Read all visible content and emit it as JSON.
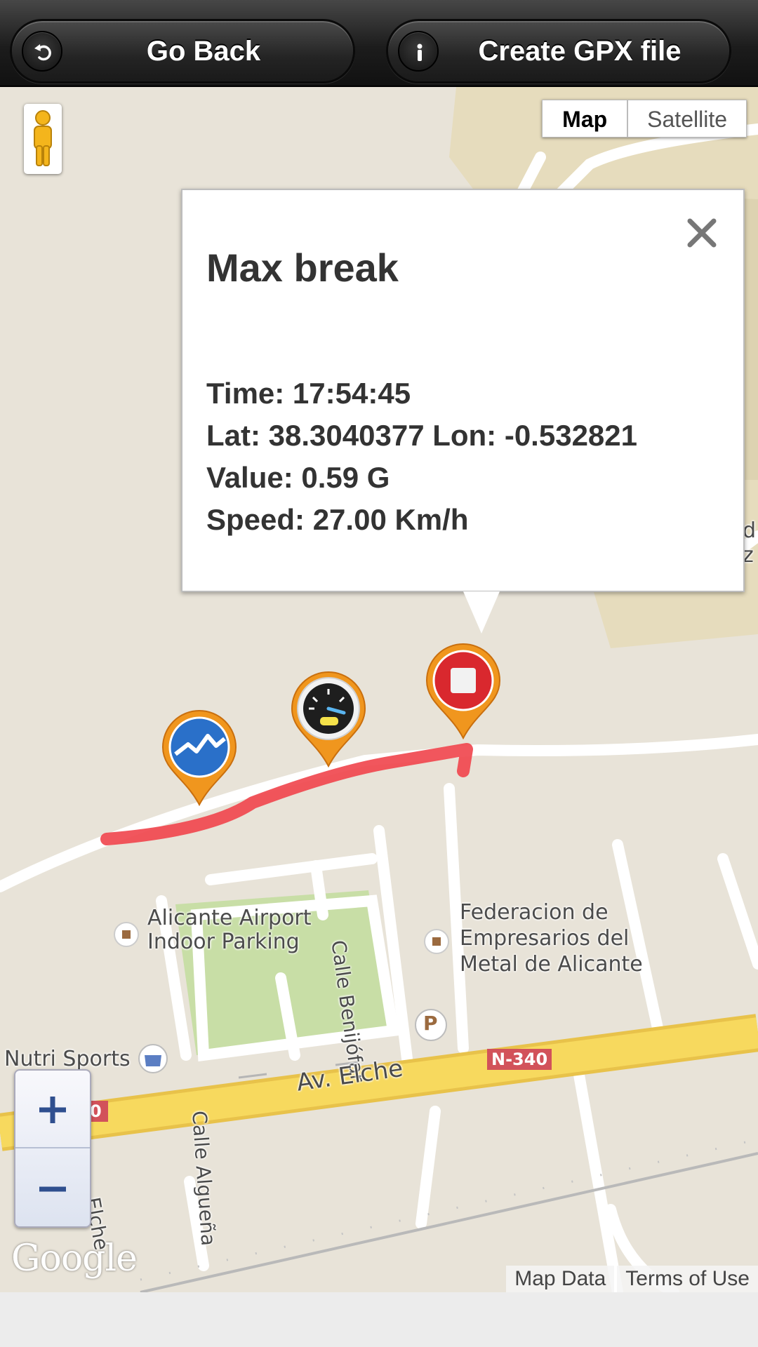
{
  "toolbar": {
    "back_label": "Go Back",
    "back_icon": "undo-arrow-icon",
    "gpx_label": "Create GPX file",
    "gpx_icon": "info-icon"
  },
  "map": {
    "type_control": {
      "map_label": "Map",
      "satellite_label": "Satellite",
      "selected": "Map"
    },
    "pegman_icon": "pegman-street-view-icon",
    "labels": {
      "parking": "Alicante Airport\nIndoor Parking",
      "parking_line1": "Alicante Airport",
      "parking_line2": "Indoor Parking",
      "federacion_line1": "Federacion de",
      "federacion_line2": "Empresarios del",
      "federacion_line3": "Metal de Alicante",
      "street_benijofar": "Calle Benijófar",
      "street_elche": "Av. Elche",
      "street_alguena": "Calle Algueña",
      "street_elche_vertical": "Elche",
      "shop": "Nutri Sports",
      "road_badge": "N-340",
      "road_badge_left": "0",
      "parking_symbol": "P",
      "edge_fragment_1": "d",
      "edge_fragment_2": "z"
    },
    "markers": [
      {
        "name": "chart-marker",
        "icon": "chart-line-icon"
      },
      {
        "name": "speed-marker",
        "icon": "speedometer-icon"
      },
      {
        "name": "stop-marker",
        "icon": "stop-icon"
      }
    ],
    "colors": {
      "route": "#f0484f",
      "marker": "#f0961e",
      "road_major": "#f7d95e"
    },
    "attribution": {
      "logo": "Google",
      "map_data": "Map Data",
      "terms": "Terms of Use"
    }
  },
  "infowindow": {
    "title": "Max break",
    "time": "Time: 17:54:45",
    "latlon": "Lat: 38.3040377 Lon: -0.532821",
    "value": "Value: 0.59 G",
    "speed": "Speed: 27.00 Km/h",
    "close_icon": "close-icon"
  },
  "zoom": {
    "in_icon": "plus-icon",
    "out_icon": "minus-icon"
  }
}
